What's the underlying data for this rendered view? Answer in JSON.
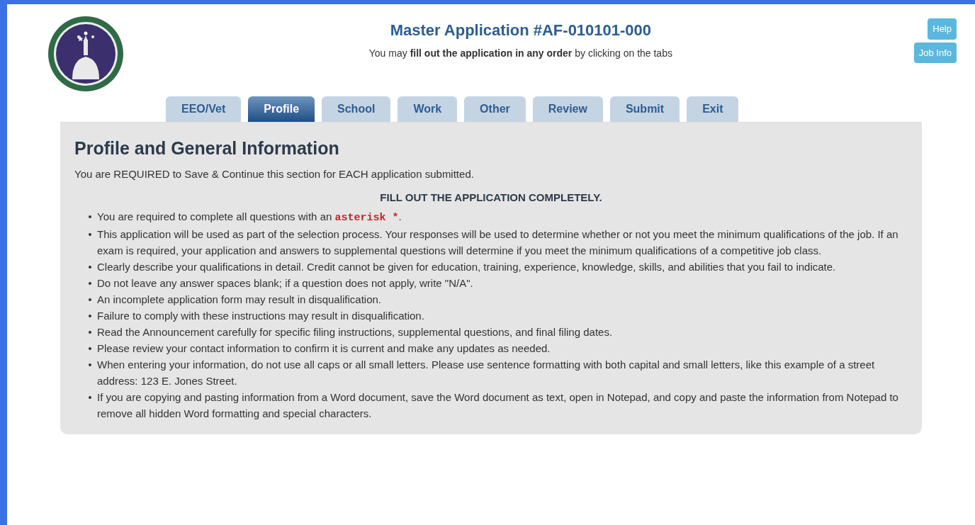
{
  "header": {
    "title": "Master Application #AF-010101-000",
    "subtitle": "You may **fill out the application in any order** by clicking on the tabs"
  },
  "buttons": [
    "Help",
    "Job Info"
  ],
  "tabs": [
    {
      "label": "EEO/Vet",
      "selected": false
    },
    {
      "label": "Profile",
      "selected": true
    },
    {
      "label": "School",
      "selected": false
    },
    {
      "label": "Work",
      "selected": false
    },
    {
      "label": "Other",
      "selected": false
    },
    {
      "label": "Review",
      "selected": false
    },
    {
      "label": "Submit",
      "selected": false
    },
    {
      "label": "Exit",
      "selected": false
    }
  ],
  "section": {
    "heading": "Profile and General Information",
    "note": "You are REQUIRED to Save & Continue this section for EACH application submitted.",
    "subheading": "FILL OUT THE APPLICATION COMPLETELY.",
    "bullets": [
      {
        "text": "You are required to complete all questions with an ",
        "highlight": "asterisk *",
        "after": "."
      },
      {
        "text": "This application will be used as part of the selection process. Your responses will be used to determine whether or not you meet the minimum qualifications of the job. If an exam is required, your application and answers to supplemental questions will determine if you meet the minimum qualifications of a competitive job class."
      },
      {
        "text": "Clearly describe your qualifications in detail. Credit cannot be given for education, training, experience, knowledge, skills, and abilities that you fail to indicate."
      },
      {
        "text": "Do not leave any answer spaces blank; if a question does not apply, write \"N/A\"."
      },
      {
        "text": "An incomplete application form may result in disqualification."
      },
      {
        "text": "Failure to comply with these instructions may result in disqualification."
      },
      {
        "text": "Read the Announcement carefully for specific filing instructions, supplemental questions, and final filing dates."
      },
      {
        "text": "Please review your contact information to confirm it is current and make any updates as needed."
      },
      {
        "text": "When entering your information, do not use all caps or all small letters. Please use sentence formatting with both capital and small letters, like this example of a street address: 123 E. Jones Street."
      },
      {
        "text": "If you are copying and pasting information from a Word document, save the Word document as text, open in Notepad, and copy and paste the information from Notepad to remove all hidden Word formatting and special characters."
      }
    ]
  }
}
